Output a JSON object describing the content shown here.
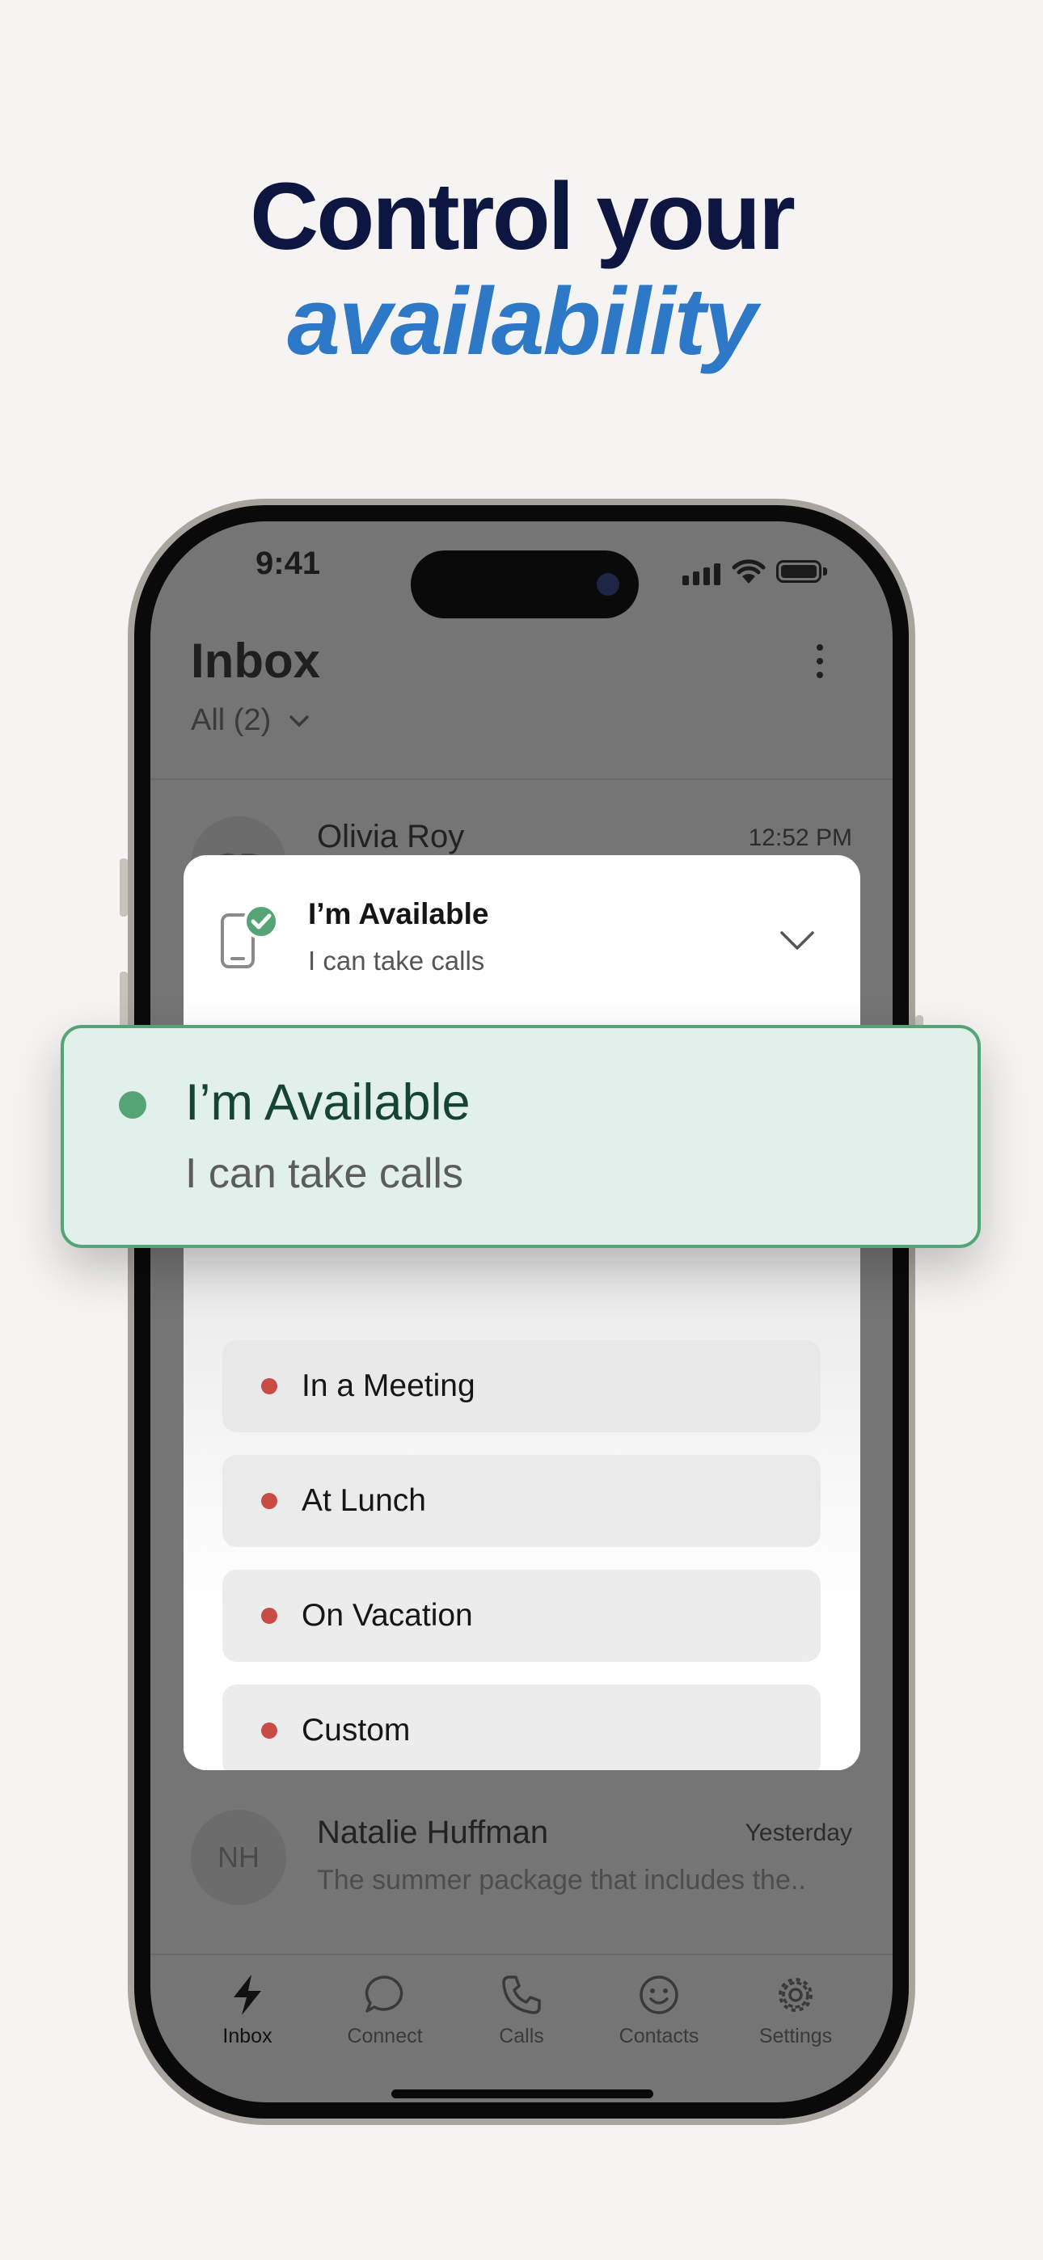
{
  "headline": {
    "line1": "Control your",
    "line2": "availability"
  },
  "status_bar": {
    "time": "9:41"
  },
  "inbox": {
    "title": "Inbox",
    "filter_label": "All (2)"
  },
  "conversations": [
    {
      "initials": "OR",
      "name": "Olivia Roy",
      "time": "12:52 PM",
      "preview": ""
    },
    {
      "initials": "NH",
      "name": "Natalie Huffman",
      "time": "Yesterday",
      "preview": "The summer package that includes the.."
    }
  ],
  "availability_modal": {
    "current_title": "I’m Available",
    "current_subtitle": "I can take calls",
    "selected_option": {
      "title": "I’m Available",
      "subtitle": "I can take calls"
    },
    "options": [
      {
        "label": "In a Meeting"
      },
      {
        "label": "At Lunch"
      },
      {
        "label": "On Vacation"
      },
      {
        "label": "Custom"
      }
    ]
  },
  "tabbar": {
    "items": [
      {
        "label": "Inbox",
        "icon": "bolt-icon",
        "active": true
      },
      {
        "label": "Connect",
        "icon": "chat-bubble-icon",
        "active": false
      },
      {
        "label": "Calls",
        "icon": "phone-icon",
        "active": false
      },
      {
        "label": "Contacts",
        "icon": "smiley-icon",
        "active": false
      },
      {
        "label": "Settings",
        "icon": "gear-icon",
        "active": false
      }
    ]
  },
  "colors": {
    "headline_dark": "#0d1640",
    "headline_accent": "#2d79c7",
    "available_green": "#55a476",
    "busy_red": "#c84b45",
    "selected_bg": "#e1f0ea"
  }
}
